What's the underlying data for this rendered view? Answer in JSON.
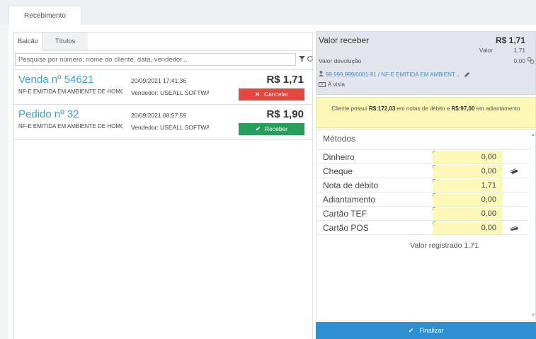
{
  "main_tab": "Recebimento",
  "subtabs": [
    "Balcão",
    "Títulos"
  ],
  "search": {
    "placeholder": "Pesquise por número, nome do cliente, data, vendedor..."
  },
  "orders": [
    {
      "number": "Venda nº 54621",
      "date": "20/09/2021 17:41:36",
      "description": "NF-E EMITIDA EM AMBIENTE DE HOMOLOGACAO",
      "seller": "Vendedor: USEALL SOFTWARE",
      "amount": "R$ 1,71",
      "action_label": "Cancelar",
      "action_color": "#e5473f"
    },
    {
      "number": "Pedido nº 32",
      "date": "20/09/2021 08:57:59",
      "description": "NF-E EMITIDA EM AMBIENTE DE HOMOLOGACAO",
      "seller": "Vendedor: USEALL SOFTWARE",
      "amount": "R$ 1,90",
      "action_label": "Receber",
      "action_color": "#25a05a"
    }
  ],
  "summary": {
    "title": "Valor receber",
    "total": "R$ 1,71",
    "valor_label": "Valor",
    "valor_value": "1,71",
    "devolucao_label": "Valor devolução",
    "devolucao_value": "0,00",
    "client": "99.999.999/0001-91 / NF-E EMITIDA EM AMBIENT...",
    "payment_term": "À vista"
  },
  "notice": {
    "prefix": "Cliente possui ",
    "debit": "R$:172,03",
    "middle": " em notas de débito e ",
    "advance": "R$:97,00",
    "suffix": " em adiantamento"
  },
  "methods": {
    "title": "Métodos",
    "rows": [
      {
        "label": "Dinheiro",
        "value": "0,00"
      },
      {
        "label": "Cheque",
        "value": "0,00",
        "icon": "card-icon"
      },
      {
        "label": "Nota de débito",
        "value": "1,71"
      },
      {
        "label": "Adiantamento",
        "value": "0,00"
      },
      {
        "label": "Cartão TEF",
        "value": "0,00"
      },
      {
        "label": "Cartão POS",
        "value": "0,00",
        "icon": "card-icon"
      }
    ],
    "registered": "Valor registrado 1,71"
  },
  "finalize_label": "Finalizar",
  "colors": {
    "accent": "#2f8fd3",
    "link": "#3aa0d8",
    "highlight": "#fbf8b8"
  }
}
